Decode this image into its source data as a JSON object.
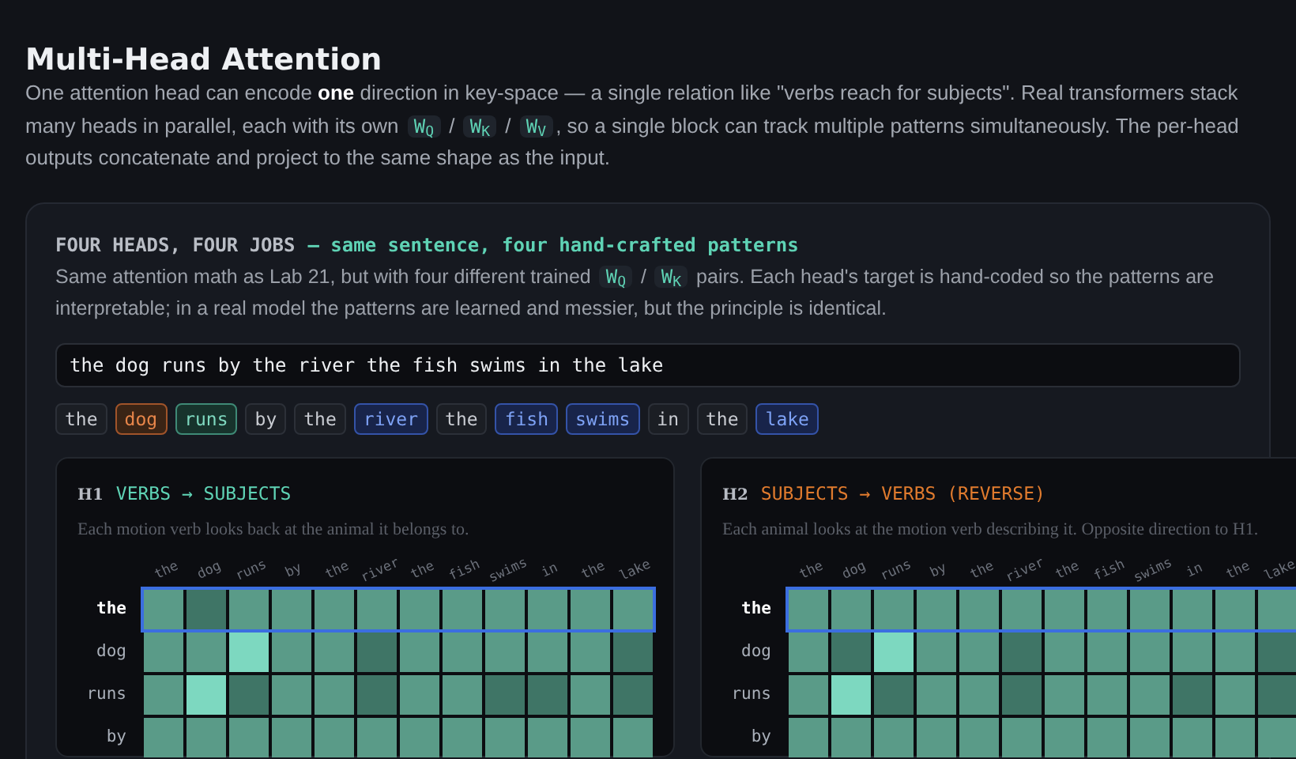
{
  "title": "Multi-Head Attention",
  "intro": [
    {
      "kind": "text",
      "text": "One attention head can encode **one** direction in key-space — a single relation like \"verbs reach for subjects\". Real transformers stack many heads in parallel, each with its own "
    },
    {
      "kind": "code",
      "text": "W$_{Q}$"
    },
    {
      "kind": "text",
      "text": " / "
    },
    {
      "kind": "code",
      "text": "W$_{K}$"
    },
    {
      "kind": "text",
      "text": " / "
    },
    {
      "kind": "code",
      "text": "W$_{V}$"
    },
    {
      "kind": "text",
      "text": ", so a single block can track multiple patterns simultaneously. The per-head outputs concatenate and project to the same shape as the input."
    }
  ],
  "card": {
    "label": "FOUR HEADS, FOUR JOBS",
    "subtitle": "— same sentence, four hand-crafted patterns",
    "description": [
      {
        "kind": "text",
        "text": "Same attention math as Lab 21, but with four different trained "
      },
      {
        "kind": "code",
        "text": "W$_{Q}$"
      },
      {
        "kind": "text",
        "text": " / "
      },
      {
        "kind": "code",
        "text": "W$_{K}$"
      },
      {
        "kind": "text",
        "text": " pairs. Each head's target is hand-coded so the patterns are interpretable; in a real model the patterns are learned and messier, but the principle is identical."
      }
    ],
    "sentence": "the dog runs by the river the fish swims in the lake",
    "tokens": [
      {
        "text": "the",
        "kind": "plain"
      },
      {
        "text": "dog",
        "kind": "subject"
      },
      {
        "text": "runs",
        "kind": "verb"
      },
      {
        "text": "by",
        "kind": "plain"
      },
      {
        "text": "the",
        "kind": "plain"
      },
      {
        "text": "river",
        "kind": "noun"
      },
      {
        "text": "the",
        "kind": "plain"
      },
      {
        "text": "fish",
        "kind": "noun"
      },
      {
        "text": "swims",
        "kind": "noun"
      },
      {
        "text": "in",
        "kind": "plain"
      },
      {
        "text": "the",
        "kind": "plain"
      },
      {
        "text": "lake",
        "kind": "noun"
      }
    ],
    "heads": [
      {
        "id": "H1",
        "name": "VERBS → SUBJECTS",
        "color": "#5fd3b5",
        "description": "Each motion verb looks back at the animal it belongs to.",
        "columns": [
          "the",
          "dog",
          "runs",
          "by",
          "the",
          "river",
          "the",
          "fish",
          "swims",
          "in",
          "the",
          "lake"
        ],
        "rows": [
          {
            "label": "the",
            "selected": true,
            "cells": [
              {
                "highlighted": false,
                "dim": false
              },
              {
                "highlighted": false,
                "dim": true
              },
              {
                "highlighted": false,
                "dim": false
              },
              {
                "highlighted": false,
                "dim": false
              },
              {
                "highlighted": false,
                "dim": false
              },
              {
                "highlighted": false,
                "dim": false
              },
              {
                "highlighted": false,
                "dim": false
              },
              {
                "highlighted": false,
                "dim": false
              },
              {
                "highlighted": false,
                "dim": false
              },
              {
                "highlighted": false,
                "dim": false
              },
              {
                "highlighted": false,
                "dim": false
              },
              {
                "highlighted": false,
                "dim": false
              }
            ]
          },
          {
            "label": "dog",
            "selected": false,
            "cells": [
              {
                "highlighted": false,
                "dim": false
              },
              {
                "highlighted": false,
                "dim": false
              },
              {
                "highlighted": true,
                "dim": false
              },
              {
                "highlighted": false,
                "dim": false
              },
              {
                "highlighted": false,
                "dim": false
              },
              {
                "highlighted": false,
                "dim": true
              },
              {
                "highlighted": false,
                "dim": false
              },
              {
                "highlighted": false,
                "dim": false
              },
              {
                "highlighted": false,
                "dim": false
              },
              {
                "highlighted": false,
                "dim": false
              },
              {
                "highlighted": false,
                "dim": false
              },
              {
                "highlighted": false,
                "dim": true
              }
            ]
          },
          {
            "label": "runs",
            "selected": false,
            "cells": [
              {
                "highlighted": false,
                "dim": false
              },
              {
                "highlighted": true,
                "dim": false
              },
              {
                "highlighted": false,
                "dim": true
              },
              {
                "highlighted": false,
                "dim": false
              },
              {
                "highlighted": false,
                "dim": false
              },
              {
                "highlighted": false,
                "dim": true
              },
              {
                "highlighted": false,
                "dim": false
              },
              {
                "highlighted": false,
                "dim": false
              },
              {
                "highlighted": false,
                "dim": true
              },
              {
                "highlighted": false,
                "dim": true
              },
              {
                "highlighted": false,
                "dim": false
              },
              {
                "highlighted": false,
                "dim": true
              }
            ]
          },
          {
            "label": "by",
            "selected": false,
            "cells": [
              {
                "highlighted": false,
                "dim": false
              },
              {
                "highlighted": false,
                "dim": false
              },
              {
                "highlighted": false,
                "dim": false
              },
              {
                "highlighted": false,
                "dim": false
              },
              {
                "highlighted": false,
                "dim": false
              },
              {
                "highlighted": false,
                "dim": false
              },
              {
                "highlighted": false,
                "dim": false
              },
              {
                "highlighted": false,
                "dim": false
              },
              {
                "highlighted": false,
                "dim": false
              },
              {
                "highlighted": false,
                "dim": false
              },
              {
                "highlighted": false,
                "dim": false
              },
              {
                "highlighted": false,
                "dim": false
              }
            ]
          }
        ]
      },
      {
        "id": "H2",
        "name": "SUBJECTS → VERBS (REVERSE)",
        "color": "#e07b2e",
        "description": "Each animal looks at the motion verb describing it. Opposite direction to H1.",
        "columns": [
          "the",
          "dog",
          "runs",
          "by",
          "the",
          "river",
          "the",
          "fish",
          "swims",
          "in",
          "the",
          "lake"
        ],
        "rows": [
          {
            "label": "the",
            "selected": true,
            "cells": [
              {
                "highlighted": false,
                "dim": false
              },
              {
                "highlighted": false,
                "dim": false
              },
              {
                "highlighted": false,
                "dim": false
              },
              {
                "highlighted": false,
                "dim": false
              },
              {
                "highlighted": false,
                "dim": false
              },
              {
                "highlighted": false,
                "dim": false
              },
              {
                "highlighted": false,
                "dim": false
              },
              {
                "highlighted": false,
                "dim": false
              },
              {
                "highlighted": false,
                "dim": false
              },
              {
                "highlighted": false,
                "dim": false
              },
              {
                "highlighted": false,
                "dim": false
              },
              {
                "highlighted": false,
                "dim": false
              }
            ]
          },
          {
            "label": "dog",
            "selected": false,
            "cells": [
              {
                "highlighted": false,
                "dim": false
              },
              {
                "highlighted": false,
                "dim": true
              },
              {
                "highlighted": true,
                "dim": false
              },
              {
                "highlighted": false,
                "dim": false
              },
              {
                "highlighted": false,
                "dim": false
              },
              {
                "highlighted": false,
                "dim": true
              },
              {
                "highlighted": false,
                "dim": false
              },
              {
                "highlighted": false,
                "dim": false
              },
              {
                "highlighted": false,
                "dim": false
              },
              {
                "highlighted": false,
                "dim": false
              },
              {
                "highlighted": false,
                "dim": false
              },
              {
                "highlighted": false,
                "dim": true
              }
            ]
          },
          {
            "label": "runs",
            "selected": false,
            "cells": [
              {
                "highlighted": false,
                "dim": false
              },
              {
                "highlighted": true,
                "dim": false
              },
              {
                "highlighted": false,
                "dim": true
              },
              {
                "highlighted": false,
                "dim": false
              },
              {
                "highlighted": false,
                "dim": false
              },
              {
                "highlighted": false,
                "dim": true
              },
              {
                "highlighted": false,
                "dim": false
              },
              {
                "highlighted": false,
                "dim": false
              },
              {
                "highlighted": false,
                "dim": false
              },
              {
                "highlighted": false,
                "dim": true
              },
              {
                "highlighted": false,
                "dim": false
              },
              {
                "highlighted": false,
                "dim": true
              }
            ]
          },
          {
            "label": "by",
            "selected": false,
            "cells": [
              {
                "highlighted": false,
                "dim": false
              },
              {
                "highlighted": false,
                "dim": false
              },
              {
                "highlighted": false,
                "dim": false
              },
              {
                "highlighted": false,
                "dim": false
              },
              {
                "highlighted": false,
                "dim": false
              },
              {
                "highlighted": false,
                "dim": false
              },
              {
                "highlighted": false,
                "dim": false
              },
              {
                "highlighted": false,
                "dim": false
              },
              {
                "highlighted": false,
                "dim": false
              },
              {
                "highlighted": false,
                "dim": false
              },
              {
                "highlighted": false,
                "dim": false
              },
              {
                "highlighted": false,
                "dim": false
              }
            ]
          }
        ]
      }
    ]
  }
}
